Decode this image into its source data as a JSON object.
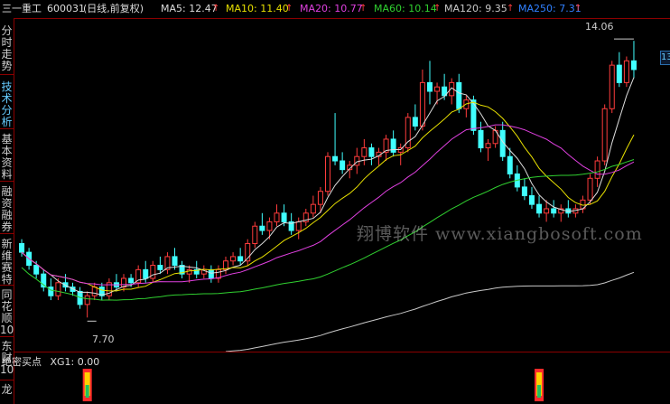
{
  "header": {
    "stock_name": "三一重工",
    "stock_code": "600031",
    "period": "(日线,前复权)",
    "ma": [
      {
        "label": "MA5: 12.47",
        "color": "#dddddd"
      },
      {
        "label": "MA10: 11.40",
        "color": "#e8e000"
      },
      {
        "label": "MA20: 10.77",
        "color": "#e040e0"
      },
      {
        "label": "MA60: 10.14",
        "color": "#30d030"
      },
      {
        "label": "MA120: 9.35",
        "color": "#c8c8c8"
      },
      {
        "label": "MA250: 7.31",
        "color": "#3080ff"
      }
    ],
    "arrow_glyph": "↑"
  },
  "left_tabs": [
    {
      "label": "分时走势",
      "active": false
    },
    {
      "label": "技术分析",
      "active": true
    },
    {
      "label": "基本资料",
      "active": false
    },
    {
      "label": "融资融券",
      "active": false
    },
    {
      "label": "新维赛特",
      "active": false
    },
    {
      "label": "同花顺10",
      "active": false
    },
    {
      "label": "东财10",
      "active": false
    },
    {
      "label": "龙",
      "active": false
    }
  ],
  "right_tab": "13",
  "price_labels": {
    "high": "14.06",
    "low": "7.70"
  },
  "indicator": {
    "name": "绝密买点",
    "value": "XG1: 0.00"
  },
  "watermark": "翔博软件  www.xiangbosoft.com",
  "colors": {
    "up": "#ff3c3c",
    "down": "#40ffff",
    "frame": "#8b0000",
    "signal_red": "#ff2a2a",
    "signal_yellow": "#ffd000",
    "signal_green": "#20c060"
  },
  "chart_data": {
    "type": "candlestick",
    "candles": [
      [
        9.4,
        9.5,
        9.1,
        9.2
      ],
      [
        9.2,
        9.3,
        8.8,
        8.9
      ],
      [
        8.9,
        9.0,
        8.6,
        8.7
      ],
      [
        8.7,
        8.8,
        8.3,
        8.4
      ],
      [
        8.4,
        8.6,
        8.1,
        8.2
      ],
      [
        8.2,
        8.6,
        8.1,
        8.5
      ],
      [
        8.5,
        8.7,
        8.3,
        8.4
      ],
      [
        8.4,
        8.5,
        8.2,
        8.3
      ],
      [
        8.3,
        8.4,
        7.9,
        8.0
      ],
      [
        8.0,
        8.3,
        7.7,
        8.2
      ],
      [
        8.2,
        8.5,
        8.1,
        8.4
      ],
      [
        8.4,
        8.5,
        8.1,
        8.2
      ],
      [
        8.2,
        8.6,
        8.1,
        8.5
      ],
      [
        8.5,
        8.7,
        8.3,
        8.4
      ],
      [
        8.4,
        8.7,
        8.3,
        8.6
      ],
      [
        8.6,
        8.7,
        8.4,
        8.5
      ],
      [
        8.5,
        8.9,
        8.4,
        8.8
      ],
      [
        8.8,
        9.0,
        8.5,
        8.6
      ],
      [
        8.6,
        9.0,
        8.5,
        8.9
      ],
      [
        8.9,
        9.1,
        8.7,
        8.8
      ],
      [
        8.8,
        9.2,
        8.7,
        9.1
      ],
      [
        9.1,
        9.3,
        8.8,
        8.9
      ],
      [
        8.9,
        9.0,
        8.6,
        8.7
      ],
      [
        8.7,
        8.9,
        8.5,
        8.8
      ],
      [
        8.8,
        9.0,
        8.6,
        8.7
      ],
      [
        8.7,
        8.9,
        8.6,
        8.8
      ],
      [
        8.8,
        8.9,
        8.5,
        8.6
      ],
      [
        8.6,
        8.9,
        8.5,
        8.8
      ],
      [
        8.8,
        9.1,
        8.7,
        9.0
      ],
      [
        9.0,
        9.2,
        8.9,
        9.1
      ],
      [
        9.1,
        9.3,
        8.9,
        9.0
      ],
      [
        9.0,
        9.5,
        8.9,
        9.4
      ],
      [
        9.4,
        9.9,
        9.3,
        9.8
      ],
      [
        9.8,
        10.1,
        9.6,
        9.7
      ],
      [
        9.7,
        10.0,
        9.5,
        9.9
      ],
      [
        9.9,
        10.3,
        9.8,
        10.1
      ],
      [
        10.1,
        10.3,
        9.8,
        9.9
      ],
      [
        9.9,
        10.1,
        9.6,
        9.7
      ],
      [
        9.7,
        10.0,
        9.5,
        9.9
      ],
      [
        9.9,
        10.2,
        9.8,
        10.1
      ],
      [
        10.1,
        10.5,
        10.0,
        10.3
      ],
      [
        10.3,
        10.7,
        10.1,
        10.6
      ],
      [
        10.6,
        11.5,
        10.5,
        11.4
      ],
      [
        11.4,
        12.4,
        11.2,
        11.3
      ],
      [
        11.3,
        11.5,
        11.0,
        11.1
      ],
      [
        11.1,
        11.3,
        10.9,
        11.2
      ],
      [
        11.2,
        11.6,
        11.0,
        11.4
      ],
      [
        11.4,
        11.8,
        11.2,
        11.6
      ],
      [
        11.6,
        11.7,
        11.2,
        11.4
      ],
      [
        11.4,
        11.6,
        11.2,
        11.5
      ],
      [
        11.5,
        11.9,
        11.3,
        11.8
      ],
      [
        11.8,
        12.0,
        11.4,
        11.5
      ],
      [
        11.5,
        11.7,
        11.2,
        11.6
      ],
      [
        11.6,
        12.4,
        11.5,
        12.3
      ],
      [
        12.3,
        12.6,
        12.0,
        12.1
      ],
      [
        12.1,
        13.4,
        12.0,
        13.1
      ],
      [
        13.1,
        13.6,
        12.6,
        12.9
      ],
      [
        12.9,
        13.1,
        12.6,
        13.0
      ],
      [
        13.0,
        13.3,
        12.7,
        12.8
      ],
      [
        12.8,
        13.2,
        12.6,
        13.1
      ],
      [
        13.1,
        13.3,
        12.4,
        12.5
      ],
      [
        12.5,
        12.8,
        12.3,
        12.7
      ],
      [
        12.7,
        12.8,
        11.9,
        12.0
      ],
      [
        12.0,
        12.2,
        11.5,
        11.6
      ],
      [
        11.6,
        11.8,
        11.3,
        11.7
      ],
      [
        11.7,
        12.1,
        11.6,
        12.0
      ],
      [
        12.0,
        12.2,
        11.3,
        11.4
      ],
      [
        11.4,
        11.6,
        10.9,
        11.0
      ],
      [
        11.0,
        11.2,
        10.6,
        10.7
      ],
      [
        10.7,
        10.9,
        10.4,
        10.5
      ],
      [
        10.5,
        10.7,
        10.2,
        10.3
      ],
      [
        10.3,
        10.5,
        10.0,
        10.1
      ],
      [
        10.1,
        10.4,
        9.9,
        10.2
      ],
      [
        10.2,
        10.4,
        10.0,
        10.1
      ],
      [
        10.1,
        10.3,
        9.9,
        10.2
      ],
      [
        10.2,
        10.4,
        10.0,
        10.1
      ],
      [
        10.1,
        10.3,
        10.0,
        10.2
      ],
      [
        10.2,
        10.5,
        10.1,
        10.4
      ],
      [
        10.4,
        11.0,
        10.3,
        10.9
      ],
      [
        10.9,
        11.4,
        10.7,
        11.3
      ],
      [
        11.3,
        12.6,
        11.2,
        12.5
      ],
      [
        12.5,
        13.6,
        12.4,
        13.5
      ],
      [
        13.5,
        13.8,
        13.0,
        13.1
      ],
      [
        13.1,
        13.7,
        13.0,
        13.6
      ],
      [
        13.6,
        14.06,
        13.2,
        13.4
      ]
    ],
    "ma_lines": [
      {
        "name": "MA5",
        "color": "#dddddd"
      },
      {
        "name": "MA10",
        "color": "#e8e000"
      },
      {
        "name": "MA20",
        "color": "#e040e0"
      },
      {
        "name": "MA60",
        "color": "#30d030"
      },
      {
        "name": "MA120",
        "color": "#c8c8c8"
      }
    ],
    "signals": [
      {
        "index": 9
      },
      {
        "index": 71
      }
    ],
    "ylim": [
      7.0,
      14.5
    ]
  }
}
